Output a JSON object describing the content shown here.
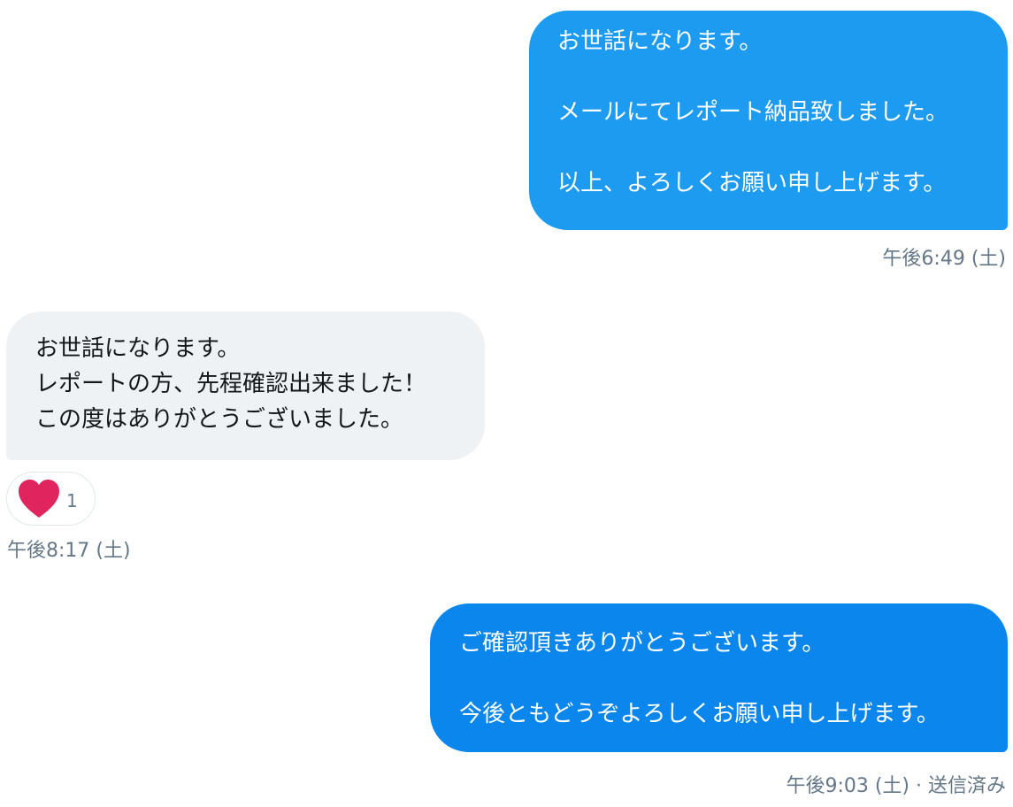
{
  "colors": {
    "bubble_outgoing_1": "#1d9bf0",
    "bubble_outgoing_2": "#0a86ec",
    "bubble_incoming": "#eff2f4",
    "heart": "#e0245e",
    "meta_text": "#657786"
  },
  "messages": [
    {
      "direction": "outgoing",
      "text": "お世話になります。\n\nメールにてレポート納品致しました。\n\n以上、よろしくお願い申し上げます。",
      "time": "午後6:49 (土)"
    },
    {
      "direction": "incoming",
      "text": "お世話になります。\nレポートの方、先程確認出来ました！\nこの度はありがとうございました。",
      "time": "午後8:17 (土)",
      "reaction": {
        "icon": "heart-icon",
        "count": "1"
      }
    },
    {
      "direction": "outgoing",
      "text": "ご確認頂きありがとうございます。\n\n今後ともどうぞよろしくお願い申し上げます。",
      "time": "午後9:03 (土) · 送信済み"
    }
  ]
}
